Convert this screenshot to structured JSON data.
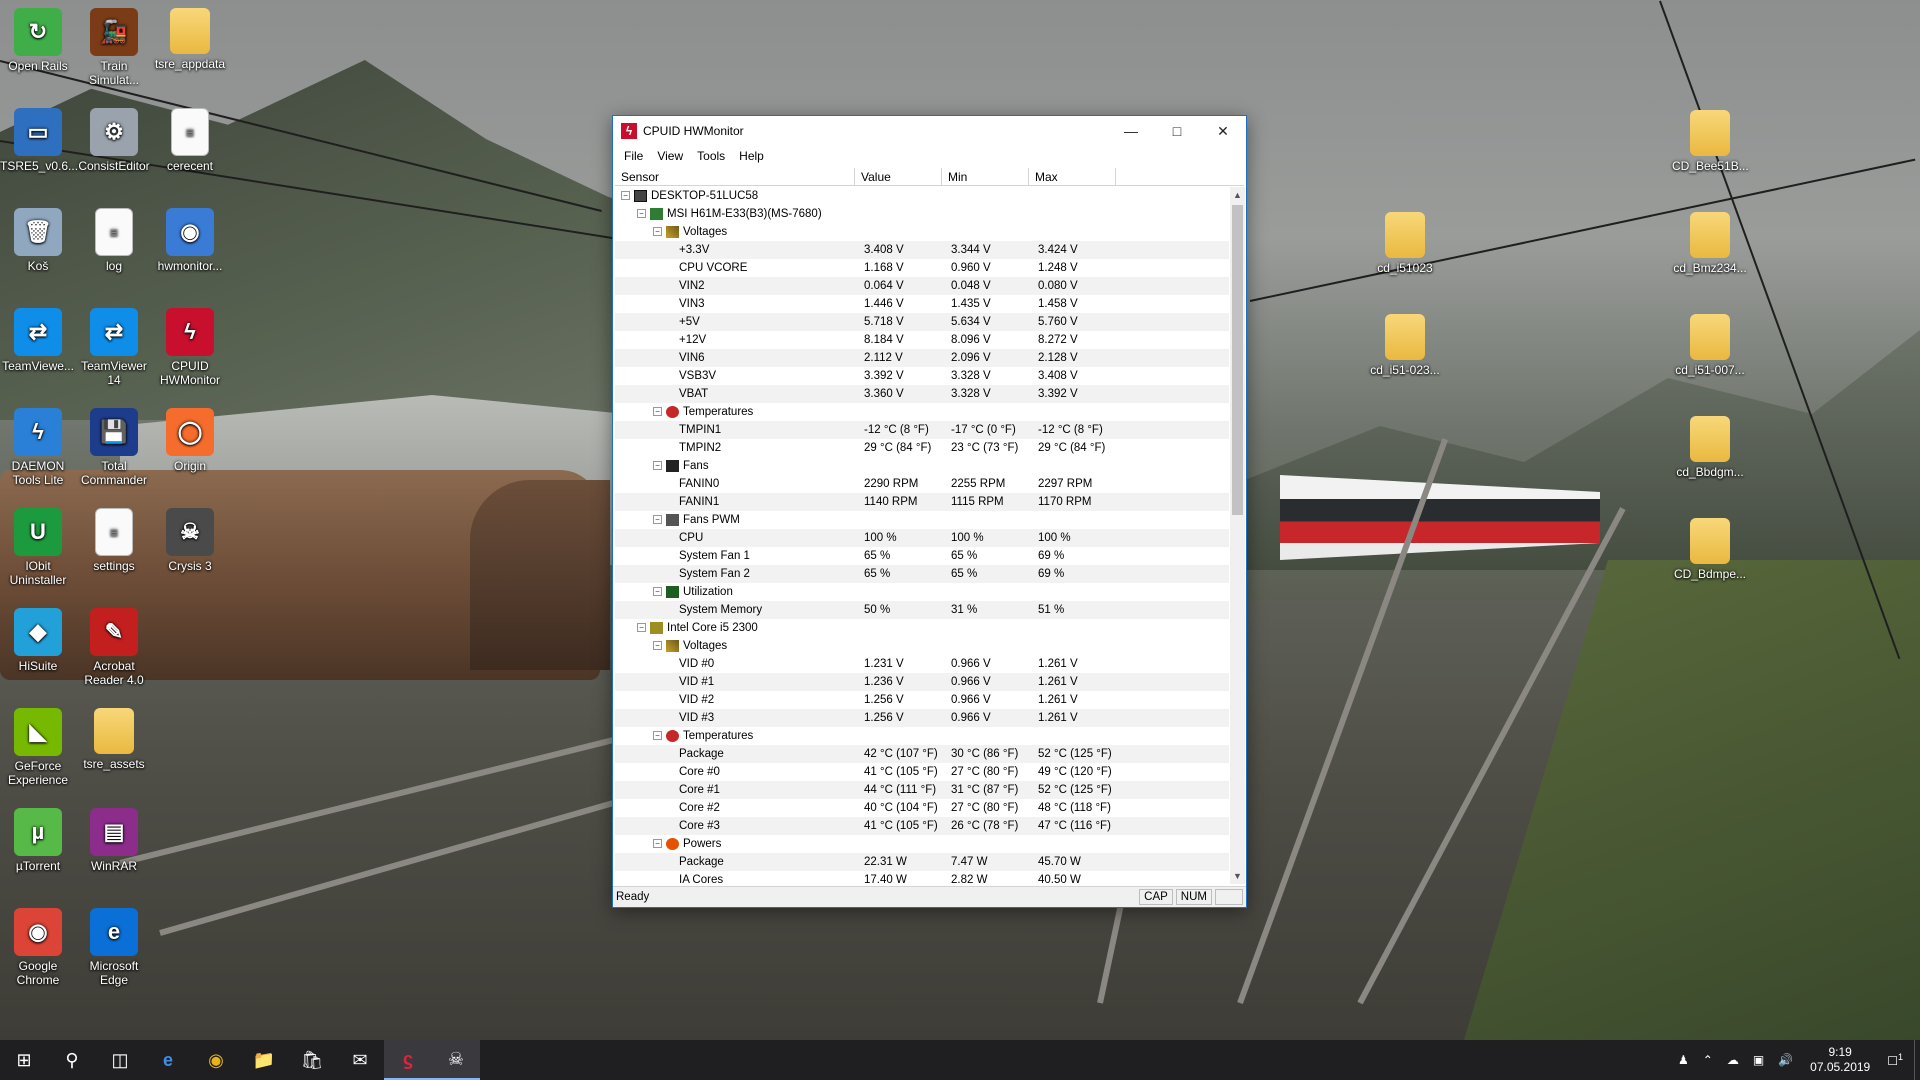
{
  "desktop_icons": [
    {
      "label": "Open Rails",
      "glyph": "↻",
      "color": "#3fae49"
    },
    {
      "label": "Train Simulat...",
      "glyph": "🚂",
      "color": "#7a3b16"
    },
    {
      "label": "tsre_appdata",
      "glyph": "",
      "color": "folder"
    },
    {
      "label": "TSRE5_v0.6...",
      "glyph": "▭",
      "color": "#2f6fbf"
    },
    {
      "label": "ConsistEditor",
      "glyph": "⚙",
      "color": "#9aa3ad"
    },
    {
      "label": "cerecent",
      "glyph": "≡",
      "color": "doc"
    },
    {
      "label": "Koš",
      "glyph": "🗑",
      "color": "#8fa7bf"
    },
    {
      "label": "log",
      "glyph": "≡",
      "color": "doc"
    },
    {
      "label": "hwmonitor...",
      "glyph": "◉",
      "color": "#3a7bd5"
    },
    {
      "label": "TeamViewe...",
      "glyph": "⇄",
      "color": "#0e8ee9"
    },
    {
      "label": "TeamViewer 14",
      "glyph": "⇄",
      "color": "#0e8ee9"
    },
    {
      "label": "CPUID HWMonitor",
      "glyph": "ϟ",
      "color": "#c8102e"
    },
    {
      "label": "DAEMON Tools Lite",
      "glyph": "ϟ",
      "color": "#2a7fd6"
    },
    {
      "label": "Total Commander",
      "glyph": "💾",
      "color": "#1e3c8c"
    },
    {
      "label": "Origin",
      "glyph": "◯",
      "color": "#f56c2d"
    },
    {
      "label": "IObit Uninstaller",
      "glyph": "U",
      "color": "#1c9b3e"
    },
    {
      "label": "settings",
      "glyph": "≡",
      "color": "doc"
    },
    {
      "label": "Crysis 3",
      "glyph": "☠",
      "color": "#4a4a4a"
    },
    {
      "label": "HiSuite",
      "glyph": "◆",
      "color": "#22a0d8"
    },
    {
      "label": "Acrobat Reader 4.0",
      "glyph": "✎",
      "color": "#c41f1f"
    },
    {
      "label": "GeForce Experience",
      "glyph": "◣",
      "color": "#76b900"
    },
    {
      "label": "tsre_assets",
      "glyph": "",
      "color": "folder"
    },
    {
      "label": "µTorrent",
      "glyph": "µ",
      "color": "#56b948"
    },
    {
      "label": "WinRAR",
      "glyph": "▤",
      "color": "#8c2d8c"
    },
    {
      "label": "Google Chrome",
      "glyph": "◉",
      "color": "#db4437"
    },
    {
      "label": "Microsoft Edge",
      "glyph": "e",
      "color": "#0a6fd6"
    }
  ],
  "right_icons": [
    {
      "label": "CD_Bee51B..."
    },
    {
      "label": "cd_i51023"
    },
    {
      "label": "cd_Bmz234..."
    },
    {
      "label": "cd_i51-023..."
    },
    {
      "label": "cd_i51-007..."
    },
    {
      "label": "cd_Bbdgm..."
    },
    {
      "label": "CD_Bdmpe..."
    }
  ],
  "window": {
    "title": "CPUID HWMonitor",
    "icon_letter": "ϟ",
    "menu": [
      "File",
      "View",
      "Tools",
      "Help"
    ],
    "columns": [
      "Sensor",
      "Value",
      "Min",
      "Max"
    ],
    "status": "Ready",
    "status_panes": [
      "CAP",
      "NUM"
    ]
  },
  "rows": [
    {
      "d": 0,
      "type": "node",
      "icon": "pc",
      "label": "DESKTOP-51LUC58"
    },
    {
      "d": 1,
      "type": "node",
      "icon": "board",
      "label": "MSI H61M-E33(B3)(MS-7680)"
    },
    {
      "d": 2,
      "type": "node",
      "icon": "volt",
      "label": "Voltages"
    },
    {
      "d": 3,
      "type": "leaf",
      "label": "+3.3V",
      "v": "3.408 V",
      "min": "3.344 V",
      "max": "3.424 V"
    },
    {
      "d": 3,
      "type": "leaf",
      "label": "CPU VCORE",
      "v": "1.168 V",
      "min": "0.960 V",
      "max": "1.248 V"
    },
    {
      "d": 3,
      "type": "leaf",
      "label": "VIN2",
      "v": "0.064 V",
      "min": "0.048 V",
      "max": "0.080 V"
    },
    {
      "d": 3,
      "type": "leaf",
      "label": "VIN3",
      "v": "1.446 V",
      "min": "1.435 V",
      "max": "1.458 V"
    },
    {
      "d": 3,
      "type": "leaf",
      "label": "+5V",
      "v": "5.718 V",
      "min": "5.634 V",
      "max": "5.760 V"
    },
    {
      "d": 3,
      "type": "leaf",
      "label": "+12V",
      "v": "8.184 V",
      "min": "8.096 V",
      "max": "8.272 V"
    },
    {
      "d": 3,
      "type": "leaf",
      "label": "VIN6",
      "v": "2.112 V",
      "min": "2.096 V",
      "max": "2.128 V"
    },
    {
      "d": 3,
      "type": "leaf",
      "label": "VSB3V",
      "v": "3.392 V",
      "min": "3.328 V",
      "max": "3.408 V"
    },
    {
      "d": 3,
      "type": "leaf",
      "label": "VBAT",
      "v": "3.360 V",
      "min": "3.328 V",
      "max": "3.392 V"
    },
    {
      "d": 2,
      "type": "node",
      "icon": "temp",
      "label": "Temperatures"
    },
    {
      "d": 3,
      "type": "leaf",
      "label": "TMPIN1",
      "v": "-12 °C  (8 °F)",
      "min": "-17 °C  (0 °F)",
      "max": "-12 °C  (8 °F)"
    },
    {
      "d": 3,
      "type": "leaf",
      "label": "TMPIN2",
      "v": "29 °C  (84 °F)",
      "min": "23 °C  (73 °F)",
      "max": "29 °C  (84 °F)"
    },
    {
      "d": 2,
      "type": "node",
      "icon": "fan",
      "label": "Fans"
    },
    {
      "d": 3,
      "type": "leaf",
      "label": "FANIN0",
      "v": "2290 RPM",
      "min": "2255 RPM",
      "max": "2297 RPM"
    },
    {
      "d": 3,
      "type": "leaf",
      "label": "FANIN1",
      "v": "1140 RPM",
      "min": "1115 RPM",
      "max": "1170 RPM"
    },
    {
      "d": 2,
      "type": "node",
      "icon": "fanpwm",
      "label": "Fans PWM"
    },
    {
      "d": 3,
      "type": "leaf",
      "label": "CPU",
      "v": "100 %",
      "min": "100 %",
      "max": "100 %"
    },
    {
      "d": 3,
      "type": "leaf",
      "label": "System Fan 1",
      "v": "65 %",
      "min": "65 %",
      "max": "69 %"
    },
    {
      "d": 3,
      "type": "leaf",
      "label": "System Fan 2",
      "v": "65 %",
      "min": "65 %",
      "max": "69 %"
    },
    {
      "d": 2,
      "type": "node",
      "icon": "util",
      "label": "Utilization"
    },
    {
      "d": 3,
      "type": "leaf",
      "label": "System Memory",
      "v": "50 %",
      "min": "31 %",
      "max": "51 %"
    },
    {
      "d": 1,
      "type": "node",
      "icon": "cpu",
      "label": "Intel Core i5 2300"
    },
    {
      "d": 2,
      "type": "node",
      "icon": "volt",
      "label": "Voltages"
    },
    {
      "d": 3,
      "type": "leaf",
      "label": "VID #0",
      "v": "1.231 V",
      "min": "0.966 V",
      "max": "1.261 V"
    },
    {
      "d": 3,
      "type": "leaf",
      "label": "VID #1",
      "v": "1.236 V",
      "min": "0.966 V",
      "max": "1.261 V"
    },
    {
      "d": 3,
      "type": "leaf",
      "label": "VID #2",
      "v": "1.256 V",
      "min": "0.966 V",
      "max": "1.261 V"
    },
    {
      "d": 3,
      "type": "leaf",
      "label": "VID #3",
      "v": "1.256 V",
      "min": "0.966 V",
      "max": "1.261 V"
    },
    {
      "d": 2,
      "type": "node",
      "icon": "temp",
      "label": "Temperatures"
    },
    {
      "d": 3,
      "type": "leaf",
      "label": "Package",
      "v": "42 °C  (107 °F)",
      "min": "30 °C  (86 °F)",
      "max": "52 °C  (125 °F)"
    },
    {
      "d": 3,
      "type": "leaf",
      "label": "Core #0",
      "v": "41 °C  (105 °F)",
      "min": "27 °C  (80 °F)",
      "max": "49 °C  (120 °F)"
    },
    {
      "d": 3,
      "type": "leaf",
      "label": "Core #1",
      "v": "44 °C  (111 °F)",
      "min": "31 °C  (87 °F)",
      "max": "52 °C  (125 °F)"
    },
    {
      "d": 3,
      "type": "leaf",
      "label": "Core #2",
      "v": "40 °C  (104 °F)",
      "min": "27 °C  (80 °F)",
      "max": "48 °C  (118 °F)"
    },
    {
      "d": 3,
      "type": "leaf",
      "label": "Core #3",
      "v": "41 °C  (105 °F)",
      "min": "26 °C  (78 °F)",
      "max": "47 °C  (116 °F)"
    },
    {
      "d": 2,
      "type": "node",
      "icon": "power",
      "label": "Powers"
    },
    {
      "d": 3,
      "type": "leaf",
      "label": "Package",
      "v": "22.31 W",
      "min": "7.47 W",
      "max": "45.70 W"
    },
    {
      "d": 3,
      "type": "leaf",
      "label": "IA Cores",
      "v": "17.40 W",
      "min": "2.82 W",
      "max": "40.50 W"
    }
  ],
  "taskbar": {
    "items": [
      "start-icon",
      "search-icon",
      "task-view-icon",
      "edge-icon",
      "chrome-icon",
      "file-explorer-icon",
      "store-icon",
      "mail-icon",
      "hwmonitor-icon",
      "game-icon"
    ],
    "time": "9:19",
    "date": "07.05.2019",
    "notification_count": "1"
  }
}
